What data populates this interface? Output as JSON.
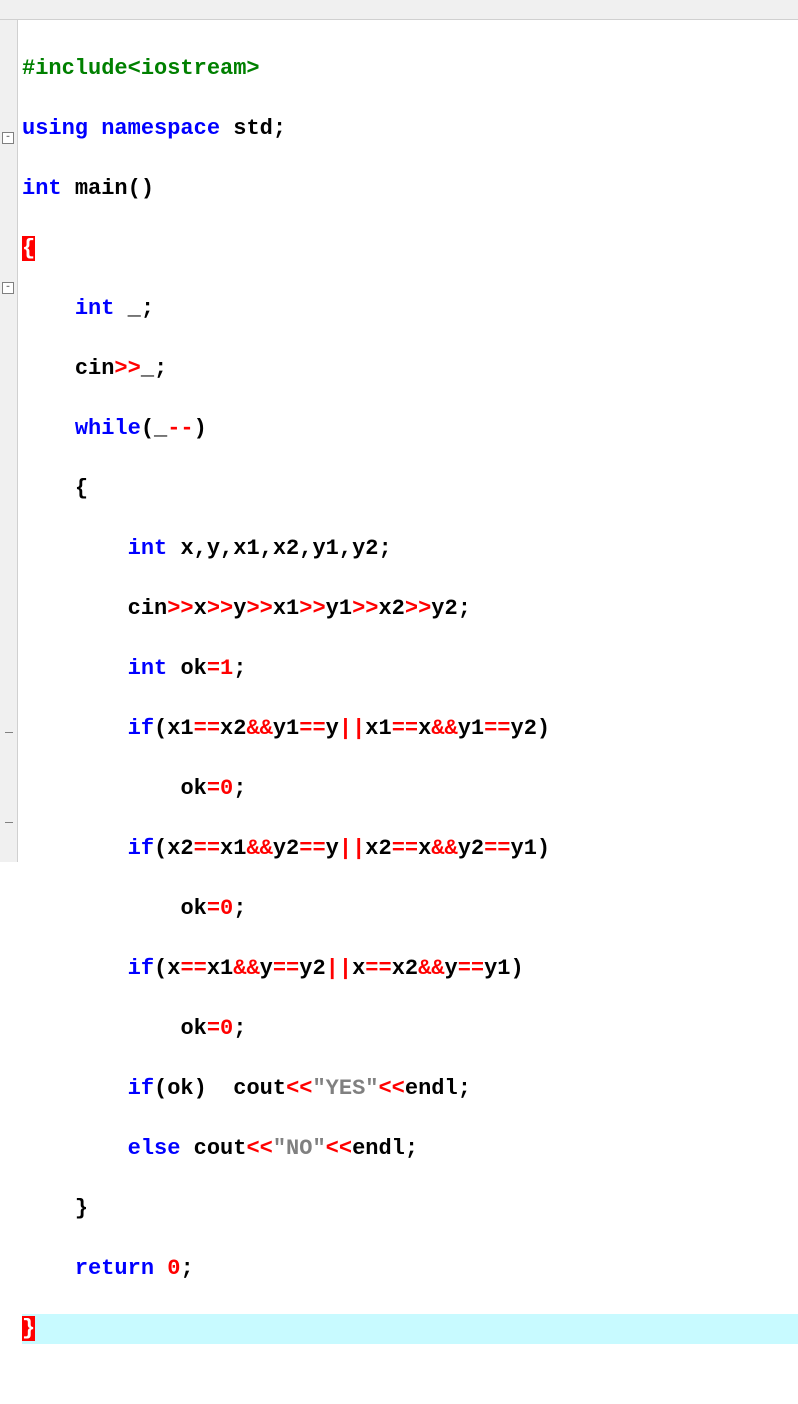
{
  "code": {
    "l1_include": "#include<iostream>",
    "l2_using": "using",
    "l2_namespace": "namespace",
    "l2_std": "std",
    "l2_semi": ";",
    "l3_int": "int",
    "l3_main": "main",
    "l3_paren": "()",
    "l4_brace": "{",
    "l5_int": "int",
    "l5_var": "_",
    "l5_semi": ";",
    "l6_cin": "cin",
    "l6_op": ">>",
    "l6_var": "_",
    "l6_semi": ";",
    "l7_while": "while",
    "l7_lp": "(",
    "l7_var": "_",
    "l7_op": "--",
    "l7_rp": ")",
    "l8_brace": "{",
    "l9_int": "int",
    "l9_vars": "x,y,x1,x2,y1,y2",
    "l9_semi": ";",
    "l10_cin": "cin",
    "l10_a": ">>",
    "l10_x": "x",
    "l10_b": ">>",
    "l10_y": "y",
    "l10_c": ">>",
    "l10_x1": "x1",
    "l10_d": ">>",
    "l10_y1": "y1",
    "l10_e": ">>",
    "l10_x2": "x2",
    "l10_f": ">>",
    "l10_y2": "y2",
    "l10_semi": ";",
    "l11_int": "int",
    "l11_ok": "ok",
    "l11_eq": "=",
    "l11_1": "1",
    "l11_semi": ";",
    "l12_if": "if",
    "l12_lp": "(",
    "l12_p1a": "x1",
    "l12_eq1": "==",
    "l12_p1b": "x2",
    "l12_and1": "&&",
    "l12_p1c": "y1",
    "l12_eq2": "==",
    "l12_p1d": "y",
    "l12_or": "||",
    "l12_p2a": "x1",
    "l12_eq3": "==",
    "l12_p2b": "x",
    "l12_and2": "&&",
    "l12_p2c": "y1",
    "l12_eq4": "==",
    "l12_p2d": "y2",
    "l12_rp": ")",
    "l13_ok": "ok",
    "l13_eq": "=",
    "l13_0": "0",
    "l13_semi": ";",
    "l14_if": "if",
    "l14_lp": "(",
    "l14_a": "x2",
    "l14_e1": "==",
    "l14_b": "x1",
    "l14_n1": "&&",
    "l14_c": "y2",
    "l14_e2": "==",
    "l14_d": "y",
    "l14_or": "||",
    "l14_e": "x2",
    "l14_e3": "==",
    "l14_f": "x",
    "l14_n2": "&&",
    "l14_g": "y2",
    "l14_e4": "==",
    "l14_h": "y1",
    "l14_rp": ")",
    "l15_ok": "ok",
    "l15_eq": "=",
    "l15_0": "0",
    "l15_semi": ";",
    "l16_if": "if",
    "l16_lp": "(",
    "l16_a": "x",
    "l16_e1": "==",
    "l16_b": "x1",
    "l16_n1": "&&",
    "l16_c": "y",
    "l16_e2": "==",
    "l16_d": "y2",
    "l16_or": "||",
    "l16_e": "x",
    "l16_e3": "==",
    "l16_f": "x2",
    "l16_n2": "&&",
    "l16_g": "y",
    "l16_e4": "==",
    "l16_h": "y1",
    "l16_rp": ")",
    "l17_ok": "ok",
    "l17_eq": "=",
    "l17_0": "0",
    "l17_semi": ";",
    "l18_if": "if",
    "l18_lp": "(",
    "l18_ok": "ok",
    "l18_rp": ")",
    "l18_cout": "cout",
    "l18_o1": "<<",
    "l18_yes": "\"YES\"",
    "l18_o2": "<<",
    "l18_endl": "endl",
    "l18_semi": ";",
    "l19_else": "else",
    "l19_cout": "cout",
    "l19_o1": "<<",
    "l19_no": "\"NO\"",
    "l19_o2": "<<",
    "l19_endl": "endl",
    "l19_semi": ";",
    "l20_brace": "}",
    "l21_return": "return",
    "l21_0": "0",
    "l21_semi": ";",
    "l22_brace": "}"
  }
}
